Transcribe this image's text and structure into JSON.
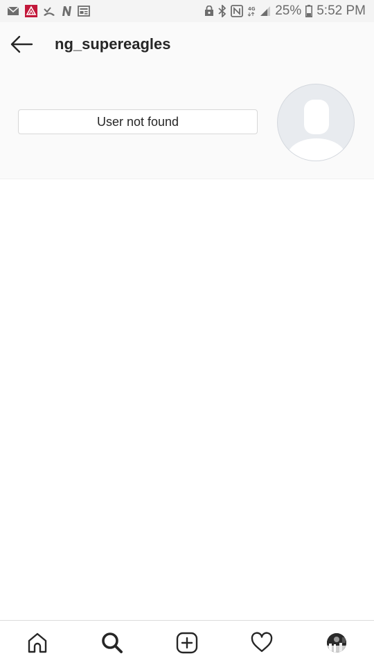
{
  "status_bar": {
    "battery_percent": "25%",
    "time": "5:52 PM",
    "icons_left": [
      "mail-icon",
      "app-notification-icon",
      "missed-call-icon",
      "n-app-icon",
      "news-icon"
    ],
    "icons_right": [
      "lock-icon",
      "bluetooth-icon",
      "nfc-icon",
      "4g-icon",
      "signal-icon",
      "battery-icon"
    ]
  },
  "header": {
    "username": "ng_supereagles",
    "not_found_label": "User not found"
  },
  "tabbar": {
    "tabs": [
      "home-icon",
      "search-icon",
      "new-post-icon",
      "activity-heart-icon",
      "profile-avatar"
    ]
  },
  "colors": {
    "header_bg": "#fafafa",
    "avatar_bg": "#e8ebef",
    "avatar_silhouette": "#ffffff",
    "status_bar_bg": "#f4f4f4"
  }
}
